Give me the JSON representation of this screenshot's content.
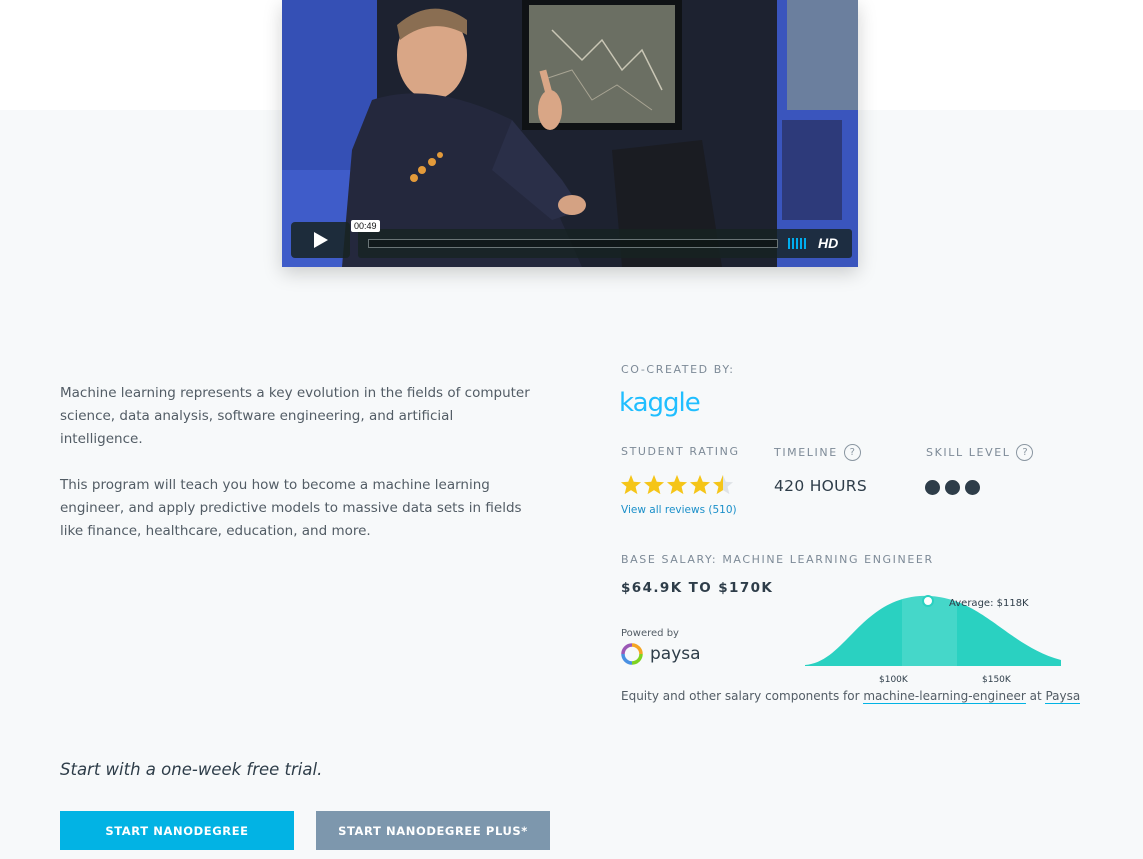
{
  "video": {
    "timecode": "00:49",
    "quality_label": "HD"
  },
  "description": {
    "paragraph1": "Machine learning represents a key evolution in the fields of computer science, data analysis, software engineering, and artificial intelligence.",
    "paragraph2": "This program will teach you how to become a machine learning engineer, and apply predictive models to massive data sets in fields like finance, healthcare, education, and more."
  },
  "cocreated": {
    "label": "CO-CREATED BY:",
    "partner": "kaggle"
  },
  "rating": {
    "label": "STUDENT RATING",
    "stars": 4.5,
    "reviews_link": "View all reviews (510)"
  },
  "timeline": {
    "label": "TIMELINE",
    "help": "?",
    "value": "420 HOURS"
  },
  "skill": {
    "label": "SKILL LEVEL",
    "help": "?",
    "level": 3
  },
  "salary": {
    "label": "BASE SALARY: MACHINE LEARNING ENGINEER",
    "range": "$64.9K TO $170K",
    "powered_by": "Powered by",
    "provider": "paysa",
    "average_label": "Average: $118K",
    "tick_1": "$100K",
    "tick_2": "$150K",
    "equity_prefix": "Equity and other salary components for ",
    "equity_link": "machine-learning-engineer",
    "equity_mid": " at ",
    "equity_provider_link": "Paysa"
  },
  "trial": {
    "text": "Start with a one-week free trial."
  },
  "buttons": {
    "primary": "START NANODEGREE",
    "secondary": "START NANODEGREE PLUS*"
  },
  "colors": {
    "accent": "#02b3e4",
    "secondary_button": "#7d97ad",
    "kaggle": "#20beff",
    "chart_fill": "#2ad1c1",
    "star": "#f5c518"
  }
}
